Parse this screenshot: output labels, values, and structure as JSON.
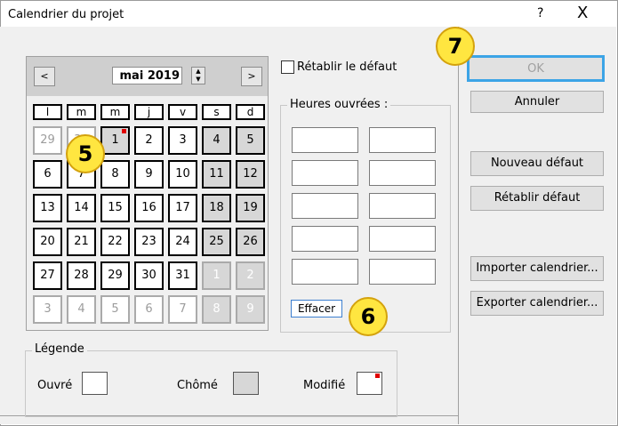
{
  "window": {
    "title": "Calendrier du projet",
    "help": "?",
    "close": "X"
  },
  "calendar": {
    "month_label": "mai 2019",
    "prev": "<",
    "next": ">",
    "days_of_week": [
      "l",
      "m",
      "m",
      "j",
      "v",
      "s",
      "d"
    ],
    "weeks": [
      [
        "29",
        "30",
        "1",
        "2",
        "3",
        "4",
        "5"
      ],
      [
        "6",
        "7",
        "8",
        "9",
        "10",
        "11",
        "12"
      ],
      [
        "13",
        "14",
        "15",
        "16",
        "17",
        "18",
        "19"
      ],
      [
        "20",
        "21",
        "22",
        "23",
        "24",
        "25",
        "26"
      ],
      [
        "27",
        "28",
        "29",
        "30",
        "31",
        "1",
        "2"
      ],
      [
        "3",
        "4",
        "5",
        "6",
        "7",
        "8",
        "9"
      ]
    ]
  },
  "reset_checkbox": {
    "label": "Rétablir le défaut",
    "checked": false
  },
  "working_hours": {
    "label": "Heures ouvrées :",
    "clear_button": "Effacer"
  },
  "legend": {
    "title": "Légende",
    "open": "Ouvré",
    "closed": "Chômé",
    "modified": "Modifié"
  },
  "buttons": {
    "ok": "OK",
    "cancel": "Annuler",
    "new_default": "Nouveau défaut",
    "reset_default": "Rétablir défaut",
    "import": "Importer calendrier...",
    "export": "Exporter calendrier..."
  },
  "callouts": {
    "c5": "5",
    "c6": "6",
    "c7": "7"
  },
  "colors": {
    "accent": "#3ca4e6",
    "badge": "#ffe640",
    "modified_marker": "#e00000",
    "nonworking": "#d7d7d7"
  }
}
